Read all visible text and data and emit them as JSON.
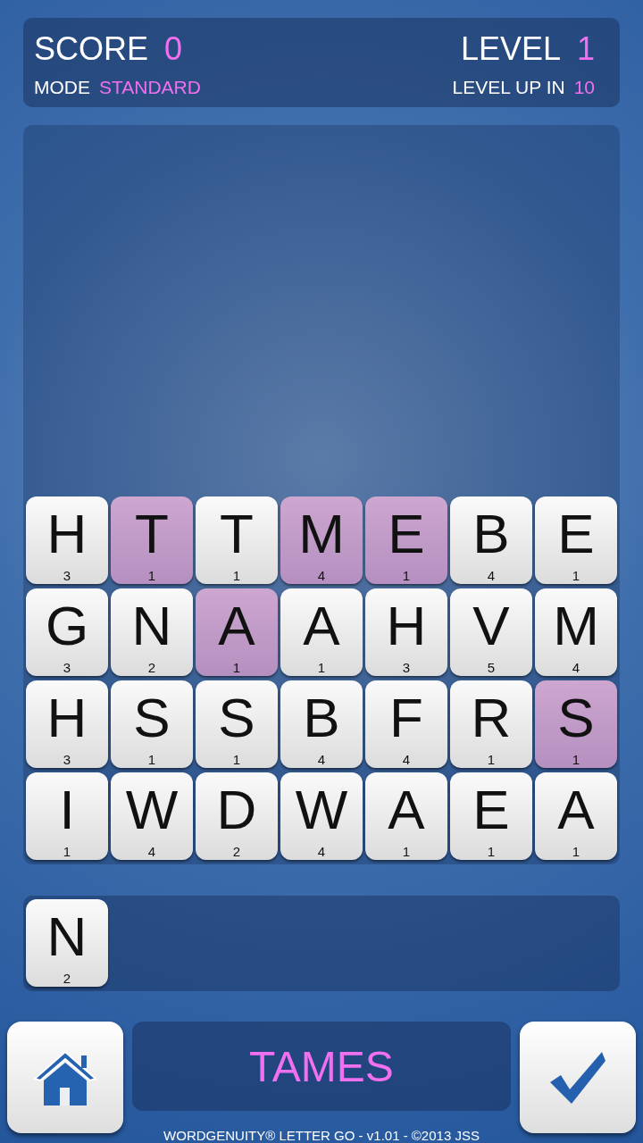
{
  "header": {
    "score_label": "SCORE",
    "score": "0",
    "level_label": "LEVEL",
    "level": "1",
    "mode_label": "MODE",
    "mode": "STANDARD",
    "level_up_label": "LEVEL UP IN",
    "level_up": "10"
  },
  "board": [
    [
      {
        "letter": "H",
        "points": "3",
        "selected": false
      },
      {
        "letter": "T",
        "points": "1",
        "selected": true
      },
      {
        "letter": "T",
        "points": "1",
        "selected": false
      },
      {
        "letter": "M",
        "points": "4",
        "selected": true
      },
      {
        "letter": "E",
        "points": "1",
        "selected": true
      },
      {
        "letter": "B",
        "points": "4",
        "selected": false
      },
      {
        "letter": "E",
        "points": "1",
        "selected": false
      }
    ],
    [
      {
        "letter": "G",
        "points": "3",
        "selected": false
      },
      {
        "letter": "N",
        "points": "2",
        "selected": false
      },
      {
        "letter": "A",
        "points": "1",
        "selected": true
      },
      {
        "letter": "A",
        "points": "1",
        "selected": false
      },
      {
        "letter": "H",
        "points": "3",
        "selected": false
      },
      {
        "letter": "V",
        "points": "5",
        "selected": false
      },
      {
        "letter": "M",
        "points": "4",
        "selected": false
      }
    ],
    [
      {
        "letter": "H",
        "points": "3",
        "selected": false
      },
      {
        "letter": "S",
        "points": "1",
        "selected": false
      },
      {
        "letter": "S",
        "points": "1",
        "selected": false
      },
      {
        "letter": "B",
        "points": "4",
        "selected": false
      },
      {
        "letter": "F",
        "points": "4",
        "selected": false
      },
      {
        "letter": "R",
        "points": "1",
        "selected": false
      },
      {
        "letter": "S",
        "points": "1",
        "selected": true
      }
    ],
    [
      {
        "letter": "I",
        "points": "1",
        "selected": false
      },
      {
        "letter": "W",
        "points": "4",
        "selected": false
      },
      {
        "letter": "D",
        "points": "2",
        "selected": false
      },
      {
        "letter": "W",
        "points": "4",
        "selected": false
      },
      {
        "letter": "A",
        "points": "1",
        "selected": false
      },
      {
        "letter": "E",
        "points": "1",
        "selected": false
      },
      {
        "letter": "A",
        "points": "1",
        "selected": false
      }
    ]
  ],
  "rack": [
    {
      "letter": "N",
      "points": "2",
      "selected": false
    }
  ],
  "word": "TAMES",
  "footer": "WORDGENUITY® LETTER GO - v1.01 - ©2013 JSS"
}
